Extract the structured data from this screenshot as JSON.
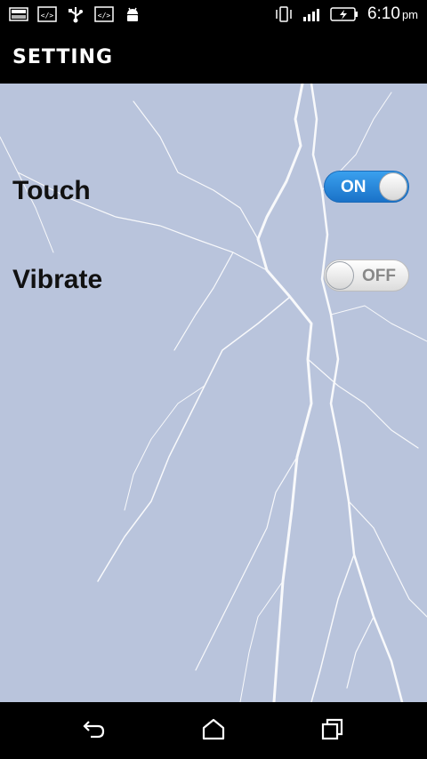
{
  "status_bar": {
    "left_icons": [
      "gallery-icon",
      "code-icon",
      "usb-icon",
      "code-icon",
      "android-icon"
    ],
    "right_icons": [
      "vibrate-icon",
      "signal-icon",
      "battery-charging-icon"
    ],
    "time": "6:10",
    "ampm": "pm"
  },
  "header": {
    "title": "SETTING"
  },
  "settings": [
    {
      "label": "Touch",
      "state": "ON"
    },
    {
      "label": "Vibrate",
      "state": "OFF"
    }
  ],
  "nav_bar": {
    "icons": [
      "back-icon",
      "home-icon",
      "recents-icon"
    ]
  },
  "colors": {
    "background": "#b9c4dc",
    "toggle_on": "#2a88dd",
    "bar": "#000000"
  }
}
